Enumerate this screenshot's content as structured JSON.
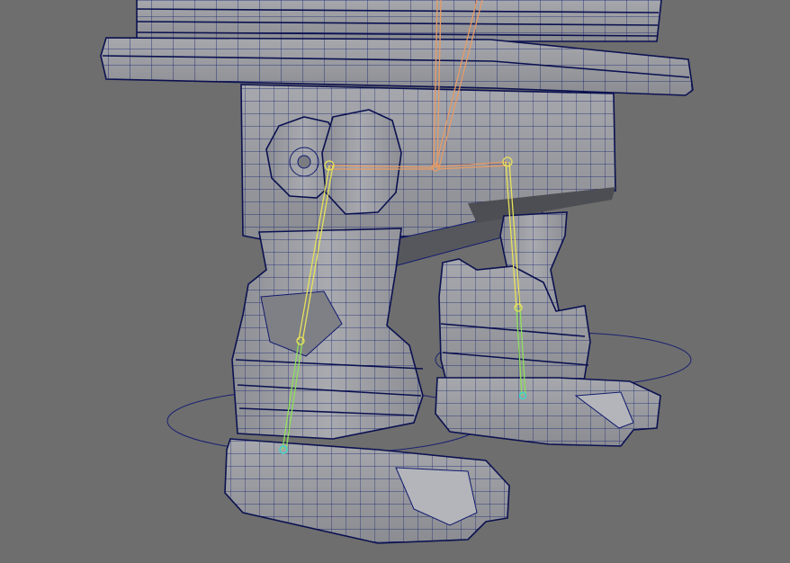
{
  "viewport": {
    "background_color": "#6e6e6e",
    "mesh_color": "#9a9ca1",
    "wireframe_color": "#121a6e",
    "skeleton_colors": {
      "spine": "#e89a64",
      "leg": "#e8e25a",
      "foot": "#8fe05a",
      "ankle_joint": "#3fd6c8"
    }
  },
  "scene": {
    "objects": [
      {
        "name": "body-top-plate",
        "icon": "mesh-icon"
      },
      {
        "name": "pelvis-block",
        "icon": "mesh-icon"
      },
      {
        "name": "hip-joint-left",
        "icon": "mesh-icon"
      },
      {
        "name": "leg-left",
        "icon": "mesh-icon"
      },
      {
        "name": "leg-right",
        "icon": "mesh-icon"
      },
      {
        "name": "foot-left",
        "icon": "mesh-icon"
      },
      {
        "name": "foot-right",
        "icon": "mesh-icon"
      }
    ],
    "controls": [
      {
        "name": "foot-control-left",
        "icon": "circle-control-icon"
      },
      {
        "name": "foot-control-right",
        "icon": "circle-control-icon"
      }
    ],
    "skeleton": [
      {
        "name": "root-bone",
        "icon": "bone-icon"
      },
      {
        "name": "hip-bone-left",
        "icon": "bone-icon"
      },
      {
        "name": "hip-bone-right",
        "icon": "bone-icon"
      },
      {
        "name": "knee-bone-left",
        "icon": "bone-icon"
      },
      {
        "name": "knee-bone-right",
        "icon": "bone-icon"
      },
      {
        "name": "ankle-joint-left",
        "icon": "joint-icon"
      },
      {
        "name": "ankle-joint-right",
        "icon": "joint-icon"
      }
    ]
  }
}
